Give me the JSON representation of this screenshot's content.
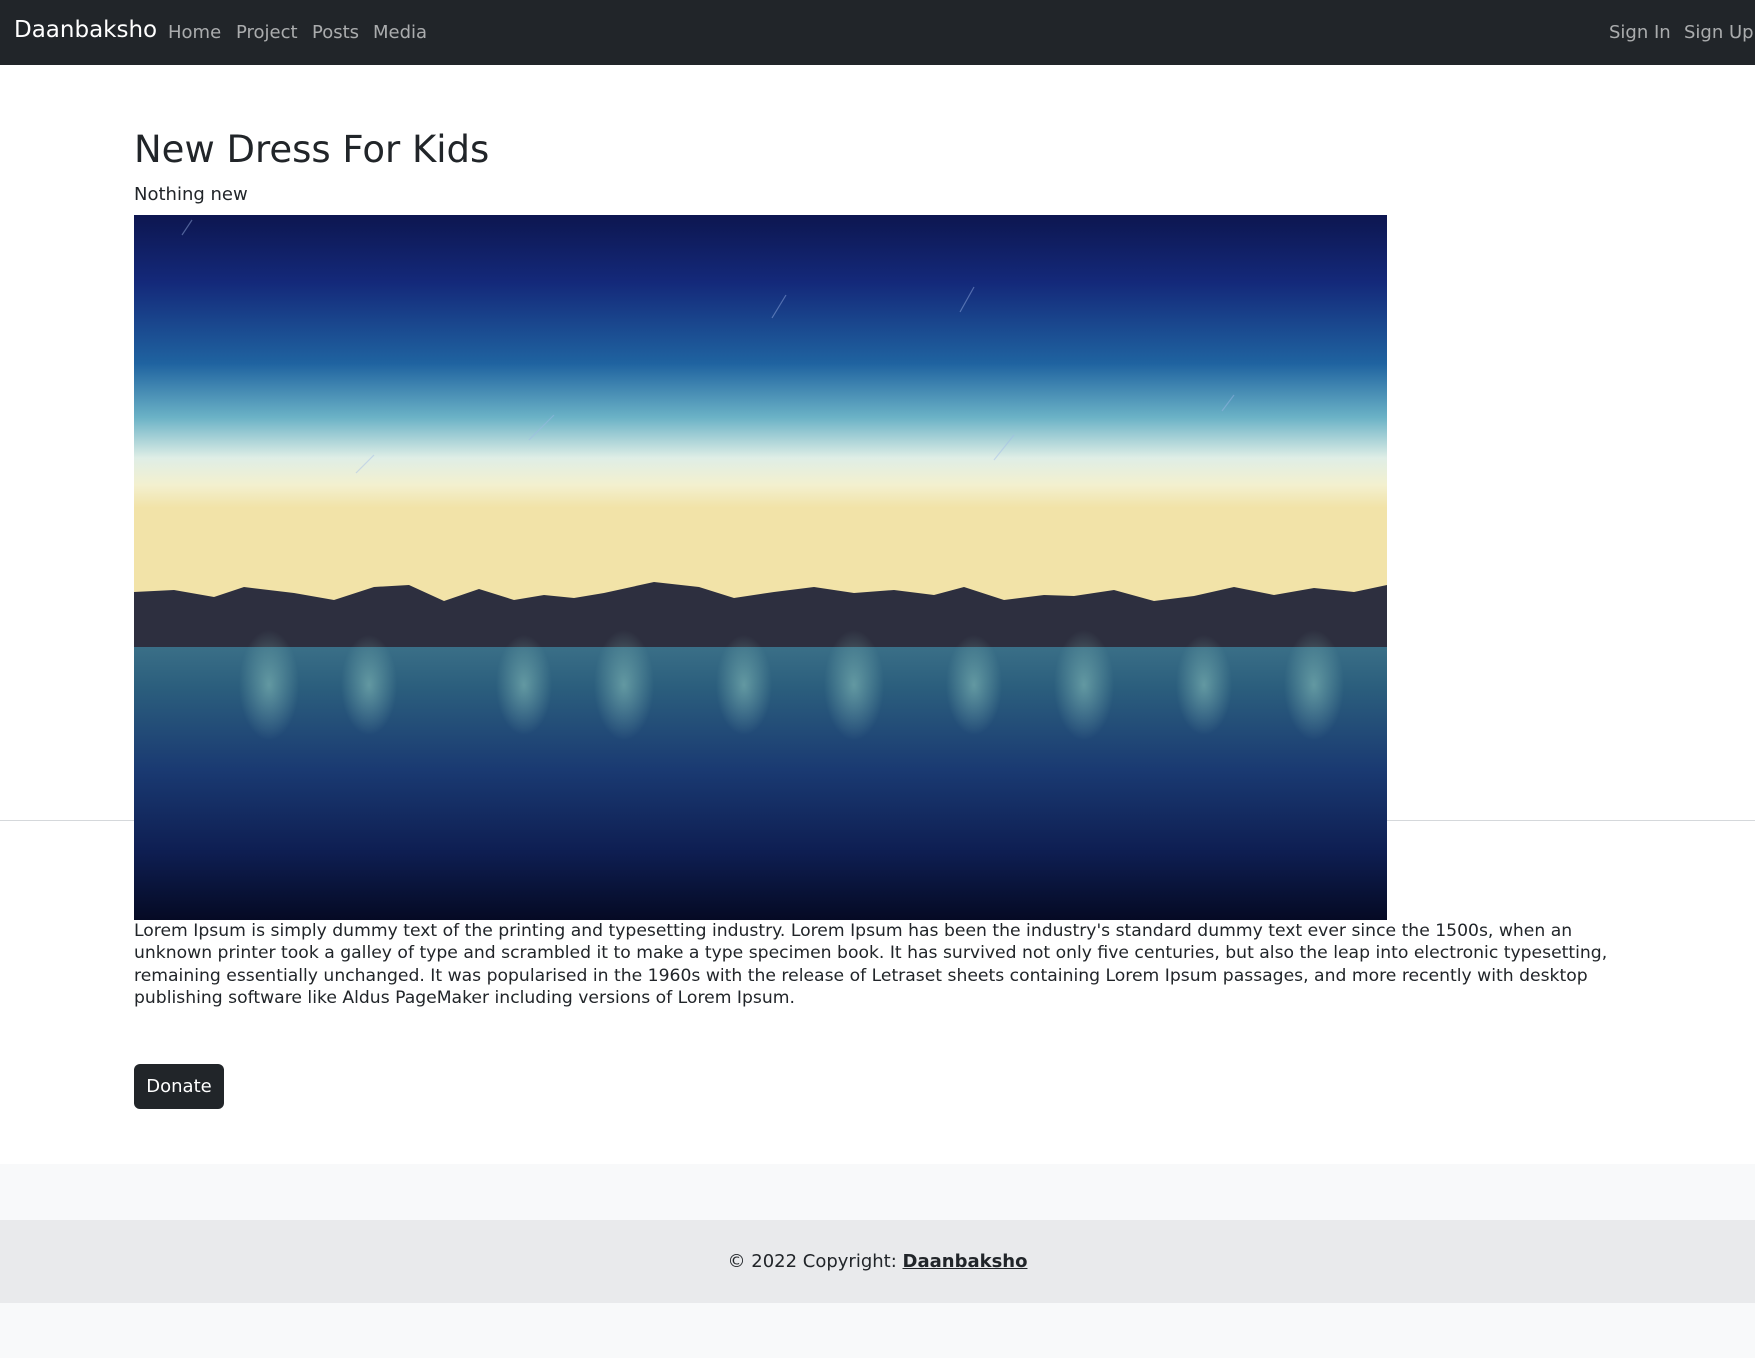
{
  "navbar": {
    "brand": "Daanbaksho",
    "links": [
      "Home",
      "Project",
      "Posts",
      "Media"
    ],
    "sign_in": "Sign In",
    "sign_up": "Sign Up"
  },
  "post": {
    "title": "New Dress For Kids",
    "subtitle": "Nothing new",
    "image": "lake-night-sky-image",
    "description": "Lorem Ipsum is simply dummy text of the printing and typesetting industry. Lorem Ipsum has been the industry's standard dummy text ever since the 1500s, when an unknown printer took a galley of type and scrambled it to make a type specimen book. It has survived not only five centuries, but also the leap into electronic typesetting, remaining essentially unchanged. It was popularised in the 1960s with the release of Letraset sheets containing Lorem Ipsum passages, and more recently with desktop publishing software like Aldus PageMaker including versions of Lorem Ipsum.",
    "donate_label": "Donate"
  },
  "footer": {
    "copyright_prefix": "© 2022 Copyright: ",
    "copyright_link": "Daanbaksho"
  },
  "colors": {
    "navbar_bg": "#212529",
    "button_bg": "#212529",
    "footer_bg": "#f8f9fa",
    "copyright_bg": "#e9eaec"
  }
}
